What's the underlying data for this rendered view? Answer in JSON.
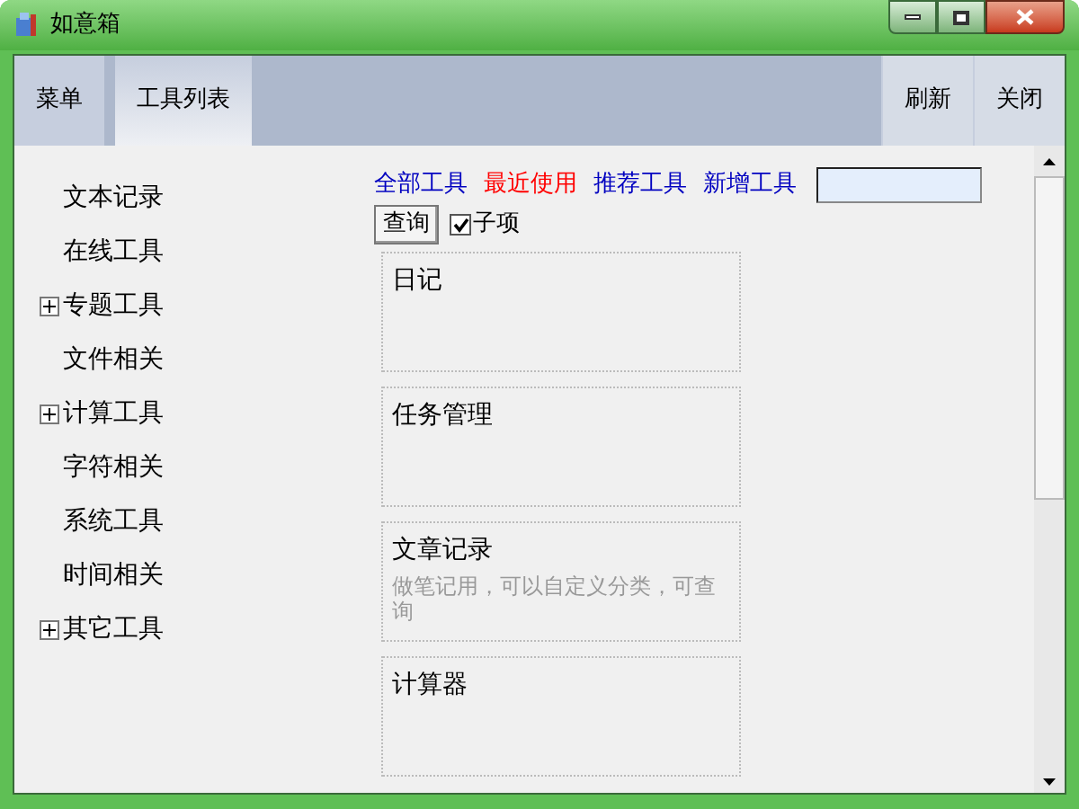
{
  "window": {
    "title": "如意箱"
  },
  "tabs": [
    {
      "label": "菜单",
      "selected": false
    },
    {
      "label": "工具列表",
      "selected": true
    }
  ],
  "actions": [
    "刷新",
    "关闭"
  ],
  "tree": [
    {
      "label": "文本记录",
      "kind": "leaf"
    },
    {
      "label": "在线工具",
      "kind": "leaf"
    },
    {
      "label": "专题工具",
      "kind": "group",
      "expanded": false
    },
    {
      "label": "文件相关",
      "kind": "leaf"
    },
    {
      "label": "计算工具",
      "kind": "group",
      "expanded": false
    },
    {
      "label": "字符相关",
      "kind": "leaf"
    },
    {
      "label": "系统工具",
      "kind": "leaf"
    },
    {
      "label": "时间相关",
      "kind": "leaf"
    },
    {
      "label": "其它工具",
      "kind": "group",
      "expanded": false
    }
  ],
  "filters": [
    {
      "label": "全部工具",
      "selected": false
    },
    {
      "label": "最近使用",
      "selected": true
    },
    {
      "label": "推荐工具",
      "selected": false
    },
    {
      "label": "新增工具",
      "selected": false
    }
  ],
  "search": {
    "button": "查询",
    "subitems": {
      "label": "子项",
      "checked": true
    }
  },
  "tools": [
    {
      "name": "日记"
    },
    {
      "name": "任务管理"
    },
    {
      "name": "文章记录",
      "description": "做笔记用，可以自定义分类，可查询"
    },
    {
      "name": "计算器"
    }
  ]
}
